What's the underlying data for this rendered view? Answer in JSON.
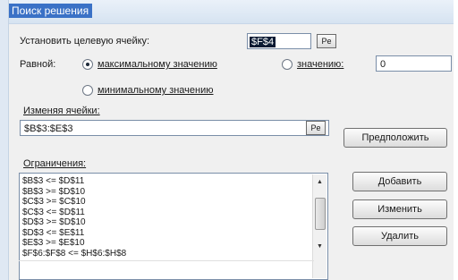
{
  "window": {
    "title": "Поиск решения"
  },
  "target": {
    "label": "Установить целевую ячейку:",
    "value": "$F$4",
    "ref_button": "Pe"
  },
  "equal_to": {
    "label": "Равной:",
    "options": [
      {
        "label": "максимальному значению",
        "selected": true
      },
      {
        "label": "значению:",
        "selected": false
      },
      {
        "label": "минимальному значению",
        "selected": false
      }
    ],
    "value_input": "0"
  },
  "changing_cells": {
    "label": "Изменяя ячейки:",
    "value": "$B$3:$E$3",
    "ref_button": "Pe",
    "guess_button": "Предположить"
  },
  "constraints": {
    "label": "Ограничения:",
    "items": [
      "$B$3 <= $D$11",
      "$B$3 >= $D$10",
      "$C$3 >= $C$10",
      "$C$3 <= $D$11",
      "$D$3 >= $D$10",
      "$D$3 <= $E$11",
      "$E$3 >= $E$10",
      "$F$6:$F$8 <= $H$6:$H$8"
    ],
    "buttons": {
      "add": "Добавить",
      "change": "Изменить",
      "delete": "Удалить"
    }
  }
}
